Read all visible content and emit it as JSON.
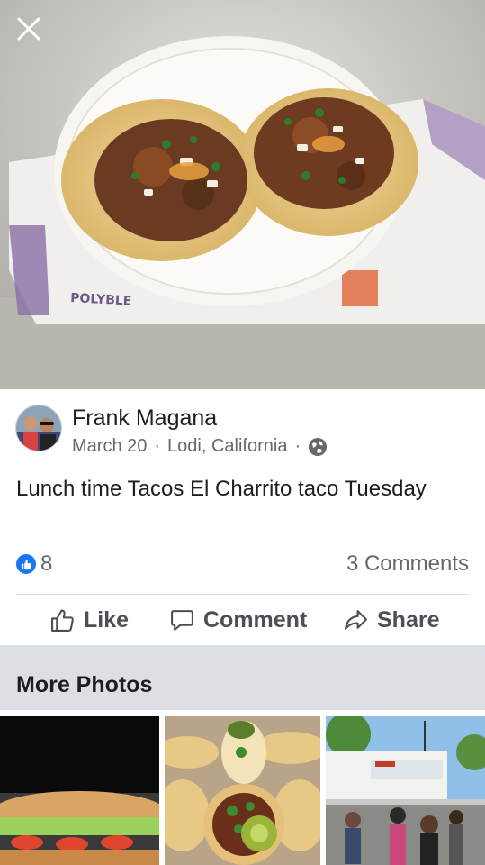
{
  "post": {
    "author": "Frank Magana",
    "date": "March 20",
    "location": "Lodi, California",
    "caption": "Lunch time Tacos El Charrito taco Tuesday",
    "like_count": "8",
    "comments_label": "3 Comments"
  },
  "actions": {
    "like": "Like",
    "comment": "Comment",
    "share": "Share"
  },
  "more_photos": {
    "title": "More Photos"
  },
  "photo_text": {
    "bag_brand": "POLYBLE"
  },
  "colors": {
    "accent": "#1877f2",
    "text_primary": "#1c1e21",
    "text_secondary": "#65676b",
    "section_bg": "#dcdfe3"
  },
  "icons": [
    "close-icon",
    "globe-icon",
    "like-reaction-icon",
    "thumbs-up-icon",
    "comment-icon",
    "share-icon"
  ]
}
